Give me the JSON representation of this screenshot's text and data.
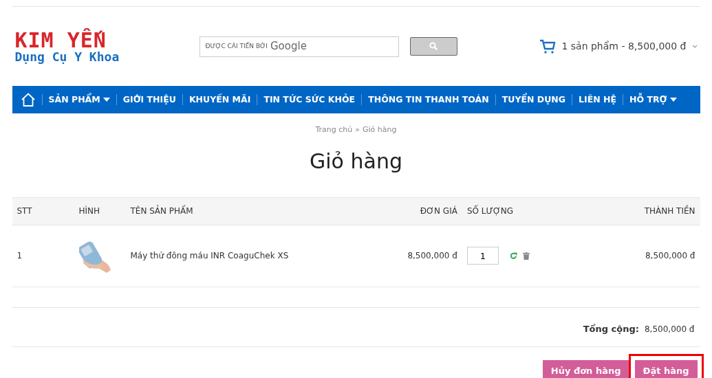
{
  "logo": {
    "title": "KIM YẾN",
    "subtitle": "Dụng Cụ Y Khoa"
  },
  "search": {
    "placeholder_prefix": "ĐƯỢC CẢI TIẾN BỞI",
    "placeholder_brand": "Google"
  },
  "cart_summary": "1 sản phẩm - 8,500,000 đ",
  "nav": [
    {
      "label": "SẢN PHẨM",
      "dropdown": true
    },
    {
      "label": "GIỚI THIỆU",
      "dropdown": false
    },
    {
      "label": "KHUYẾN MÃI",
      "dropdown": false
    },
    {
      "label": "TIN TỨC SỨC KHỎE",
      "dropdown": false
    },
    {
      "label": "THÔNG TIN THANH TOÁN",
      "dropdown": false
    },
    {
      "label": "TUYỂN DỤNG",
      "dropdown": false
    },
    {
      "label": "LIÊN HỆ",
      "dropdown": false
    },
    {
      "label": "HỖ TRỢ",
      "dropdown": true
    }
  ],
  "breadcrumb": {
    "items": [
      "Trang chủ",
      "Giỏ hàng"
    ],
    "separator": "»"
  },
  "page_title": "Giỏ hàng",
  "table": {
    "columns": [
      "STT",
      "HÌNH",
      "TÊN SẢN PHẨM",
      "ĐƠN GIÁ",
      "SỐ LƯỢNG",
      "THÀNH TIỀN"
    ],
    "rows": [
      {
        "index": "1",
        "name": "Máy thử đông máu INR CoaguChek XS",
        "unit_price": "8,500,000 đ",
        "quantity": "1",
        "total": "8,500,000 đ"
      }
    ]
  },
  "total": {
    "label": "Tổng cộng:",
    "value": "8,500,000 đ"
  },
  "buttons": [
    {
      "label": "Hủy đơn hàng",
      "highlighted": false
    },
    {
      "label": "Đặt hàng",
      "highlighted": true
    }
  ]
}
